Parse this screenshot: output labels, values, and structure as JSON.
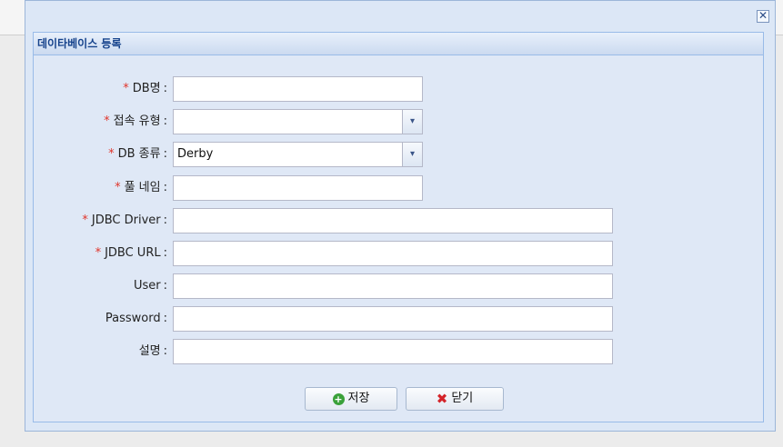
{
  "dialog": {
    "close_glyph": "✕",
    "panel_title": "데이타베이스 등록"
  },
  "form": {
    "required_marker": "*",
    "colon": ":",
    "fields": [
      {
        "label": "DB명",
        "value": ""
      },
      {
        "label": "접속 유형",
        "value": ""
      },
      {
        "label": "DB 종류",
        "value": "Derby"
      },
      {
        "label": "풀 네임",
        "value": ""
      },
      {
        "label": "JDBC Driver",
        "value": ""
      },
      {
        "label": "JDBC URL",
        "value": ""
      },
      {
        "label": "User",
        "value": ""
      },
      {
        "label": "Password",
        "value": ""
      },
      {
        "label": "설명",
        "value": ""
      }
    ],
    "dropdown_glyph": "▾"
  },
  "buttons": {
    "save_label": "저장",
    "save_icon_glyph": "+",
    "close_label": "닫기",
    "close_icon_glyph": "✖"
  },
  "colors": {
    "required": "#e0352b",
    "panel_title": "#15428b"
  }
}
